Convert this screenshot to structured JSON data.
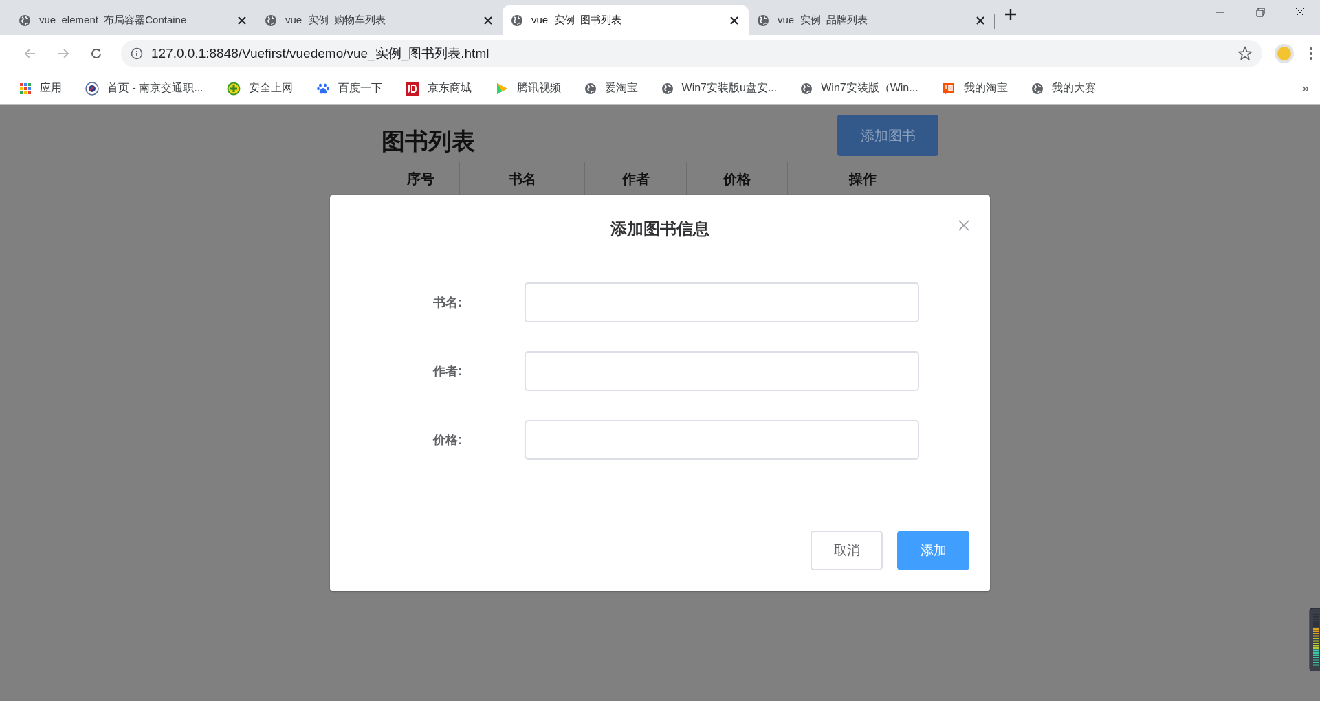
{
  "tabs": [
    {
      "title": "vue_element_布局容器Containe",
      "selected": false
    },
    {
      "title": "vue_实例_购物车列表",
      "selected": false
    },
    {
      "title": "vue_实例_图书列表",
      "selected": true
    },
    {
      "title": "vue_实例_品牌列表",
      "selected": false
    }
  ],
  "address_bar": {
    "url": "127.0.0.1:8848/Vuefirst/vuedemo/vue_实例_图书列表.html"
  },
  "bookmarks": [
    {
      "kind": "apps",
      "label": "应用"
    },
    {
      "kind": "seal",
      "label": "首页 - 南京交通职..."
    },
    {
      "kind": "plus",
      "label": "安全上网"
    },
    {
      "kind": "paw",
      "label": "百度一下"
    },
    {
      "kind": "jd",
      "label": "京东商城"
    },
    {
      "kind": "play",
      "label": "腾讯视频"
    },
    {
      "kind": "globe",
      "label": "爱淘宝"
    },
    {
      "kind": "globe",
      "label": "Win7安装版u盘安..."
    },
    {
      "kind": "globe",
      "label": "Win7安装版（Win..."
    },
    {
      "kind": "tao",
      "label": "我的淘宝"
    },
    {
      "kind": "globe",
      "label": "我的大赛"
    }
  ],
  "bookmarks_more": "»",
  "page": {
    "title": "图书列表",
    "add_button": "添加图书",
    "table": {
      "columns": [
        "序号",
        "书名",
        "作者",
        "价格",
        "操作"
      ]
    }
  },
  "dialog": {
    "title": "添加图书信息",
    "fields": [
      {
        "label": "书名:"
      },
      {
        "label": "作者:"
      },
      {
        "label": "价格:"
      }
    ],
    "buttons": [
      {
        "kind": "default",
        "label": "取消"
      },
      {
        "kind": "primary",
        "label": "添加"
      }
    ]
  }
}
